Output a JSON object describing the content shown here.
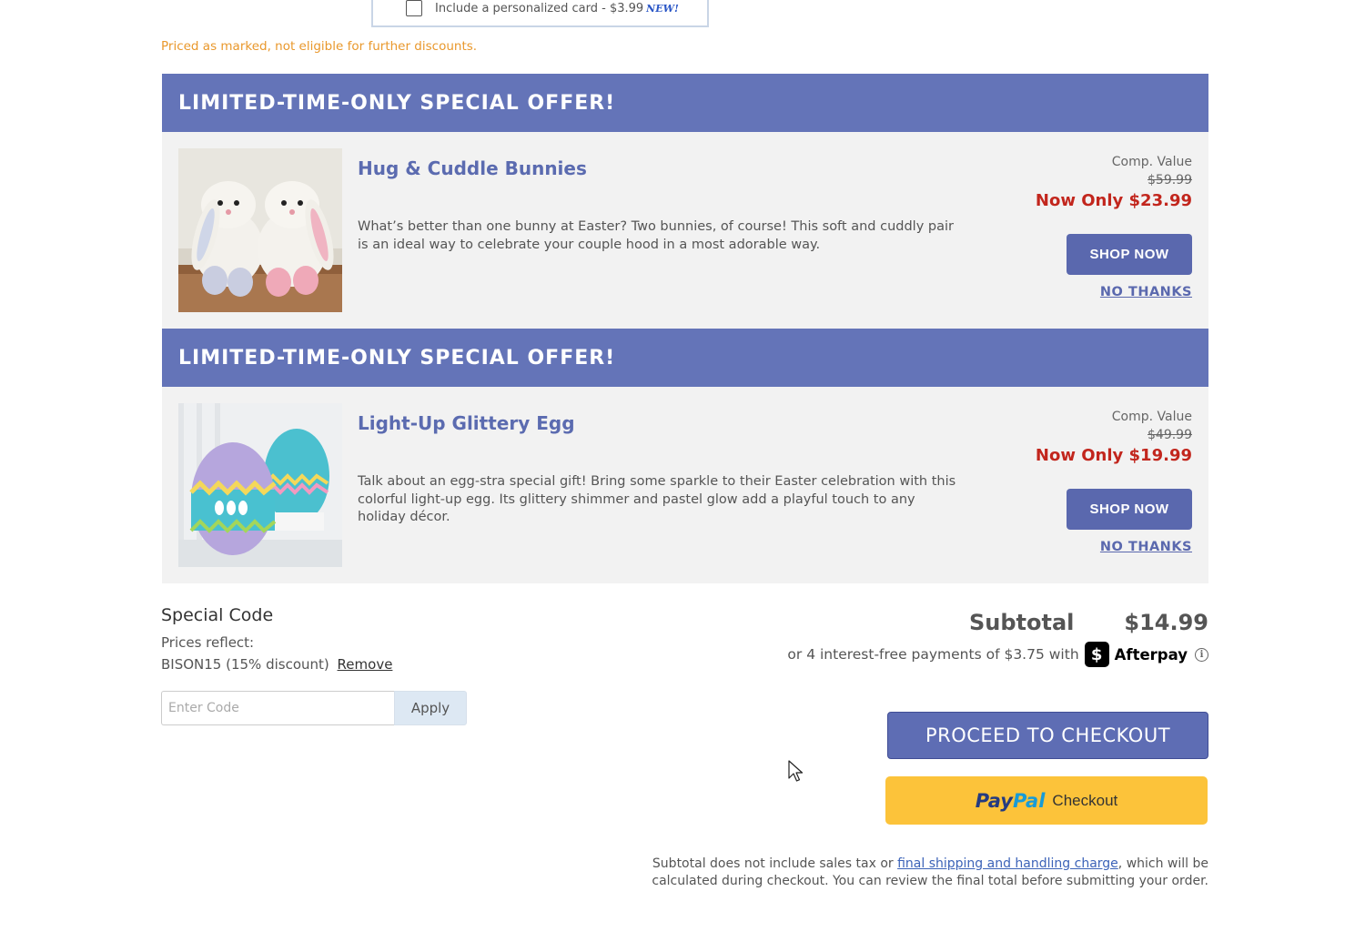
{
  "card_option": {
    "label": "Include a personalized card - $3.99",
    "badge": "NEW!"
  },
  "priced_note": "Priced as marked, not eligible for further discounts.",
  "offers": [
    {
      "header": "LIMITED-TIME-ONLY SPECIAL OFFER!",
      "title": "Hug & Cuddle Bunnies",
      "description": "What’s better than one bunny at Easter? Two bunnies, of course! This soft and cuddly pair is an ideal way to celebrate your couple hood in a most adorable way.",
      "comp_label": "Comp. Value",
      "comp_price": "$59.99",
      "now_price": "Now Only $23.99",
      "shop_label": "SHOP NOW",
      "no_thanks_label": "NO THANKS"
    },
    {
      "header": "LIMITED-TIME-ONLY SPECIAL OFFER!",
      "title": "Light-Up Glittery Egg",
      "description": "Talk about an egg-stra special gift! Bring some sparkle to their Easter celebration with this colorful light-up egg. Its glittery shimmer and pastel glow add a playful touch to any holiday décor.",
      "comp_label": "Comp. Value",
      "comp_price": "$49.99",
      "now_price": "Now Only $19.99",
      "shop_label": "SHOP NOW",
      "no_thanks_label": "NO THANKS"
    }
  ],
  "special_code": {
    "title": "Special Code",
    "prices_reflect": "Prices reflect:",
    "applied_code": "BISON15 (15% discount)",
    "remove_label": "Remove",
    "input_placeholder": "Enter Code",
    "apply_label": "Apply"
  },
  "summary": {
    "subtotal_label": "Subtotal",
    "subtotal_value": "$14.99",
    "afterpay_text": "or 4 interest-free payments of $3.75 with",
    "afterpay_logo_glyph": "$",
    "afterpay_name": "Afterpay",
    "info_glyph": "i",
    "checkout_label": "PROCEED TO CHECKOUT",
    "paypal_pay": "Pay",
    "paypal_pal": "Pal",
    "paypal_checkout": "Checkout"
  },
  "disclaimer": {
    "before": "Subtotal does not include sales tax or ",
    "link": "final shipping and handling charge",
    "after": ", which will be calculated during checkout. You can review the final total before submitting your order."
  },
  "colors": {
    "offer_header": "#6474b8",
    "button_blue": "#5a68ae",
    "price_red": "#c2261d",
    "note_orange": "#e9982c",
    "paypal_yellow": "#fcc33a"
  }
}
